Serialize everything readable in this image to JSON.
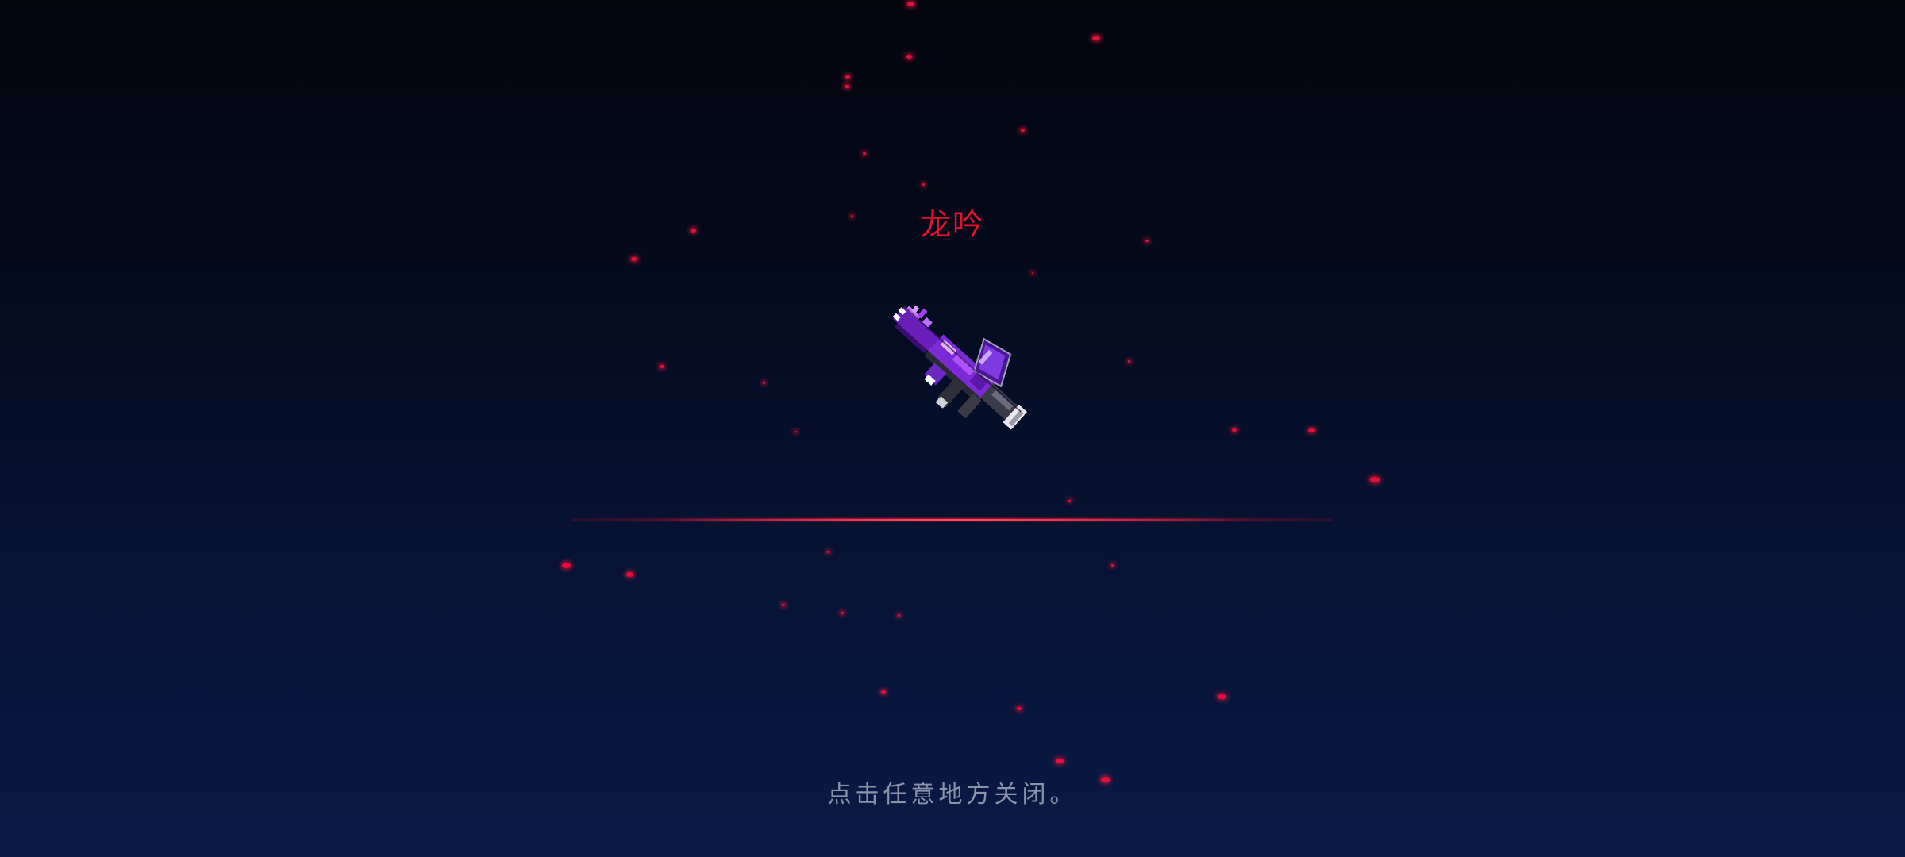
{
  "reward": {
    "item_name": "龙吟",
    "item_icon": "dragon-roar-rifle-icon",
    "item_name_color": "#e8102c"
  },
  "close_hint": "点击任意地方关闭。",
  "colors": {
    "background_top": "#03050d",
    "background_bottom": "#081a45",
    "particle": "#e0103a",
    "weapon_primary": "#8a2be2",
    "hint_text": "#8a93a8"
  }
}
